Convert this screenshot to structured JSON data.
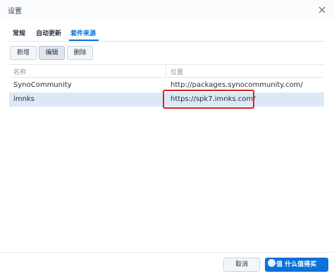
{
  "dialog": {
    "title": "设置"
  },
  "tabs": [
    {
      "label": "常规",
      "active": false
    },
    {
      "label": "自动更新",
      "active": false
    },
    {
      "label": "套件来源",
      "active": true
    }
  ],
  "toolbar": {
    "add_label": "新增",
    "edit_label": "编辑",
    "delete_label": "删除"
  },
  "grid": {
    "columns": [
      "名称",
      "位置"
    ],
    "rows": [
      {
        "name": "SynoCommunity",
        "location": "http://packages.synocommunity.com/",
        "selected": false
      },
      {
        "name": "imnks",
        "location": "https://spk7.imnks.com/",
        "selected": true
      }
    ]
  },
  "footer": {
    "cancel_label": "取消",
    "watermark": "值 什么值得买"
  },
  "colors": {
    "accent": "#0a72d9",
    "selection": "#dbe9f7",
    "annotation_box": "#e0201b"
  }
}
